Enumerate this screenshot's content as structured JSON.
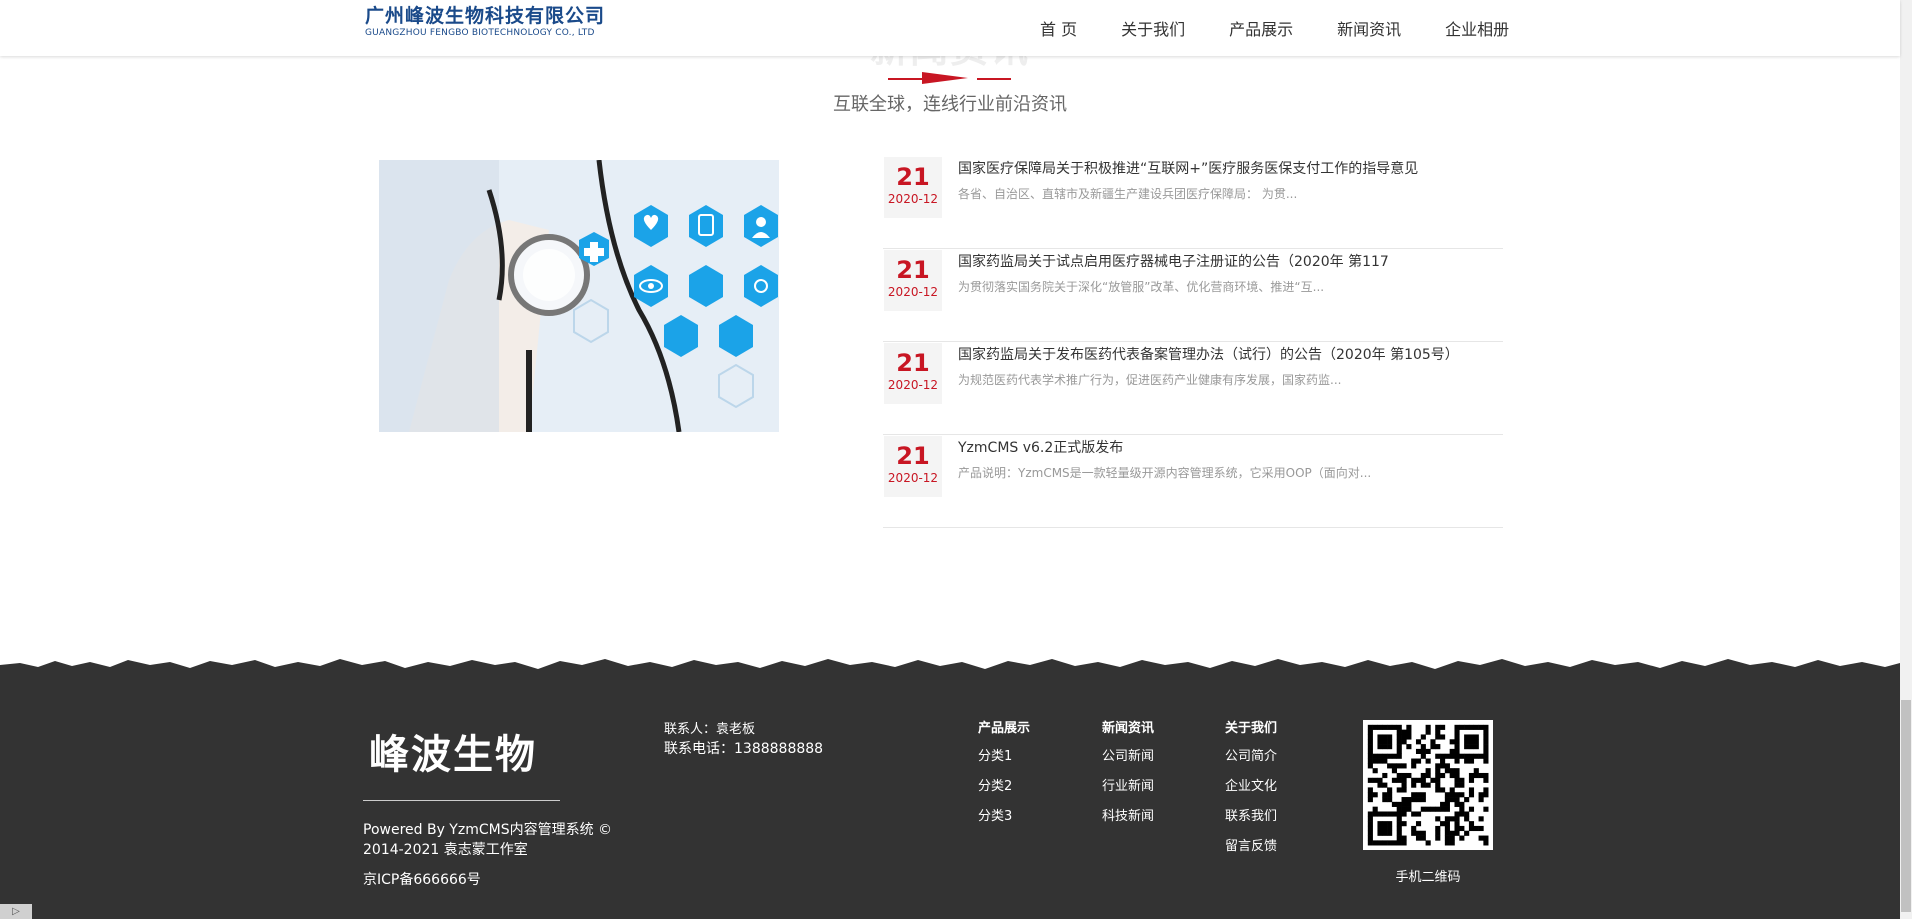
{
  "header": {
    "logo_cn": "广州峰波生物科技有限公司",
    "logo_en": "GUANGZHOU FENGBO BIOTECHNOLOGY CO., LTD",
    "nav": [
      "首 页",
      "关于我们",
      "产品展示",
      "新闻资讯",
      "企业相册"
    ]
  },
  "section": {
    "title": "新闻资讯",
    "subtitle": "互联全球，连线行业前沿资讯"
  },
  "news": [
    {
      "day": "21",
      "ym": "2020-12",
      "title": "国家医疗保障局关于积极推进“互联网+”医疗服务医保支付工作的指导意见",
      "desc": "各省、自治区、直辖市及新疆生产建设兵团医疗保障局： 为贯..."
    },
    {
      "day": "21",
      "ym": "2020-12",
      "title": "国家药监局关于试点启用医疗器械电子注册证的公告（2020年 第117",
      "desc": "为贯彻落实国务院关于深化“放管服”改革、优化营商环境、推进“互..."
    },
    {
      "day": "21",
      "ym": "2020-12",
      "title": "国家药监局关于发布医药代表备案管理办法（试行）的公告（2020年 第105号）",
      "desc": "为规范医药代表学术推广行为，促进医药产业健康有序发展，国家药监..."
    },
    {
      "day": "21",
      "ym": "2020-12",
      "title": "YzmCMS v6.2正式版发布",
      "desc": "产品说明：YzmCMS是一款轻量级开源内容管理系统，它采用OOP（面向对..."
    }
  ],
  "footer": {
    "logo": "峰波生物",
    "powered_line1": "Powered By YzmCMS内容管理系统 ©",
    "powered_line2": "2014-2021 袁志蒙工作室",
    "icp": "京ICP备666666号",
    "contact_person": "联系人：袁老板",
    "contact_phone": "联系电话：1388888888",
    "columns": [
      {
        "head": "产品展示",
        "links": [
          "分类1",
          "分类2",
          "分类3"
        ]
      },
      {
        "head": "新闻资讯",
        "links": [
          "公司新闻",
          "行业新闻",
          "科技新闻"
        ]
      },
      {
        "head": "关于我们",
        "links": [
          "公司简介",
          "企业文化",
          "联系我们",
          "留言反馈"
        ]
      }
    ],
    "qr_label": "手机二维码"
  }
}
